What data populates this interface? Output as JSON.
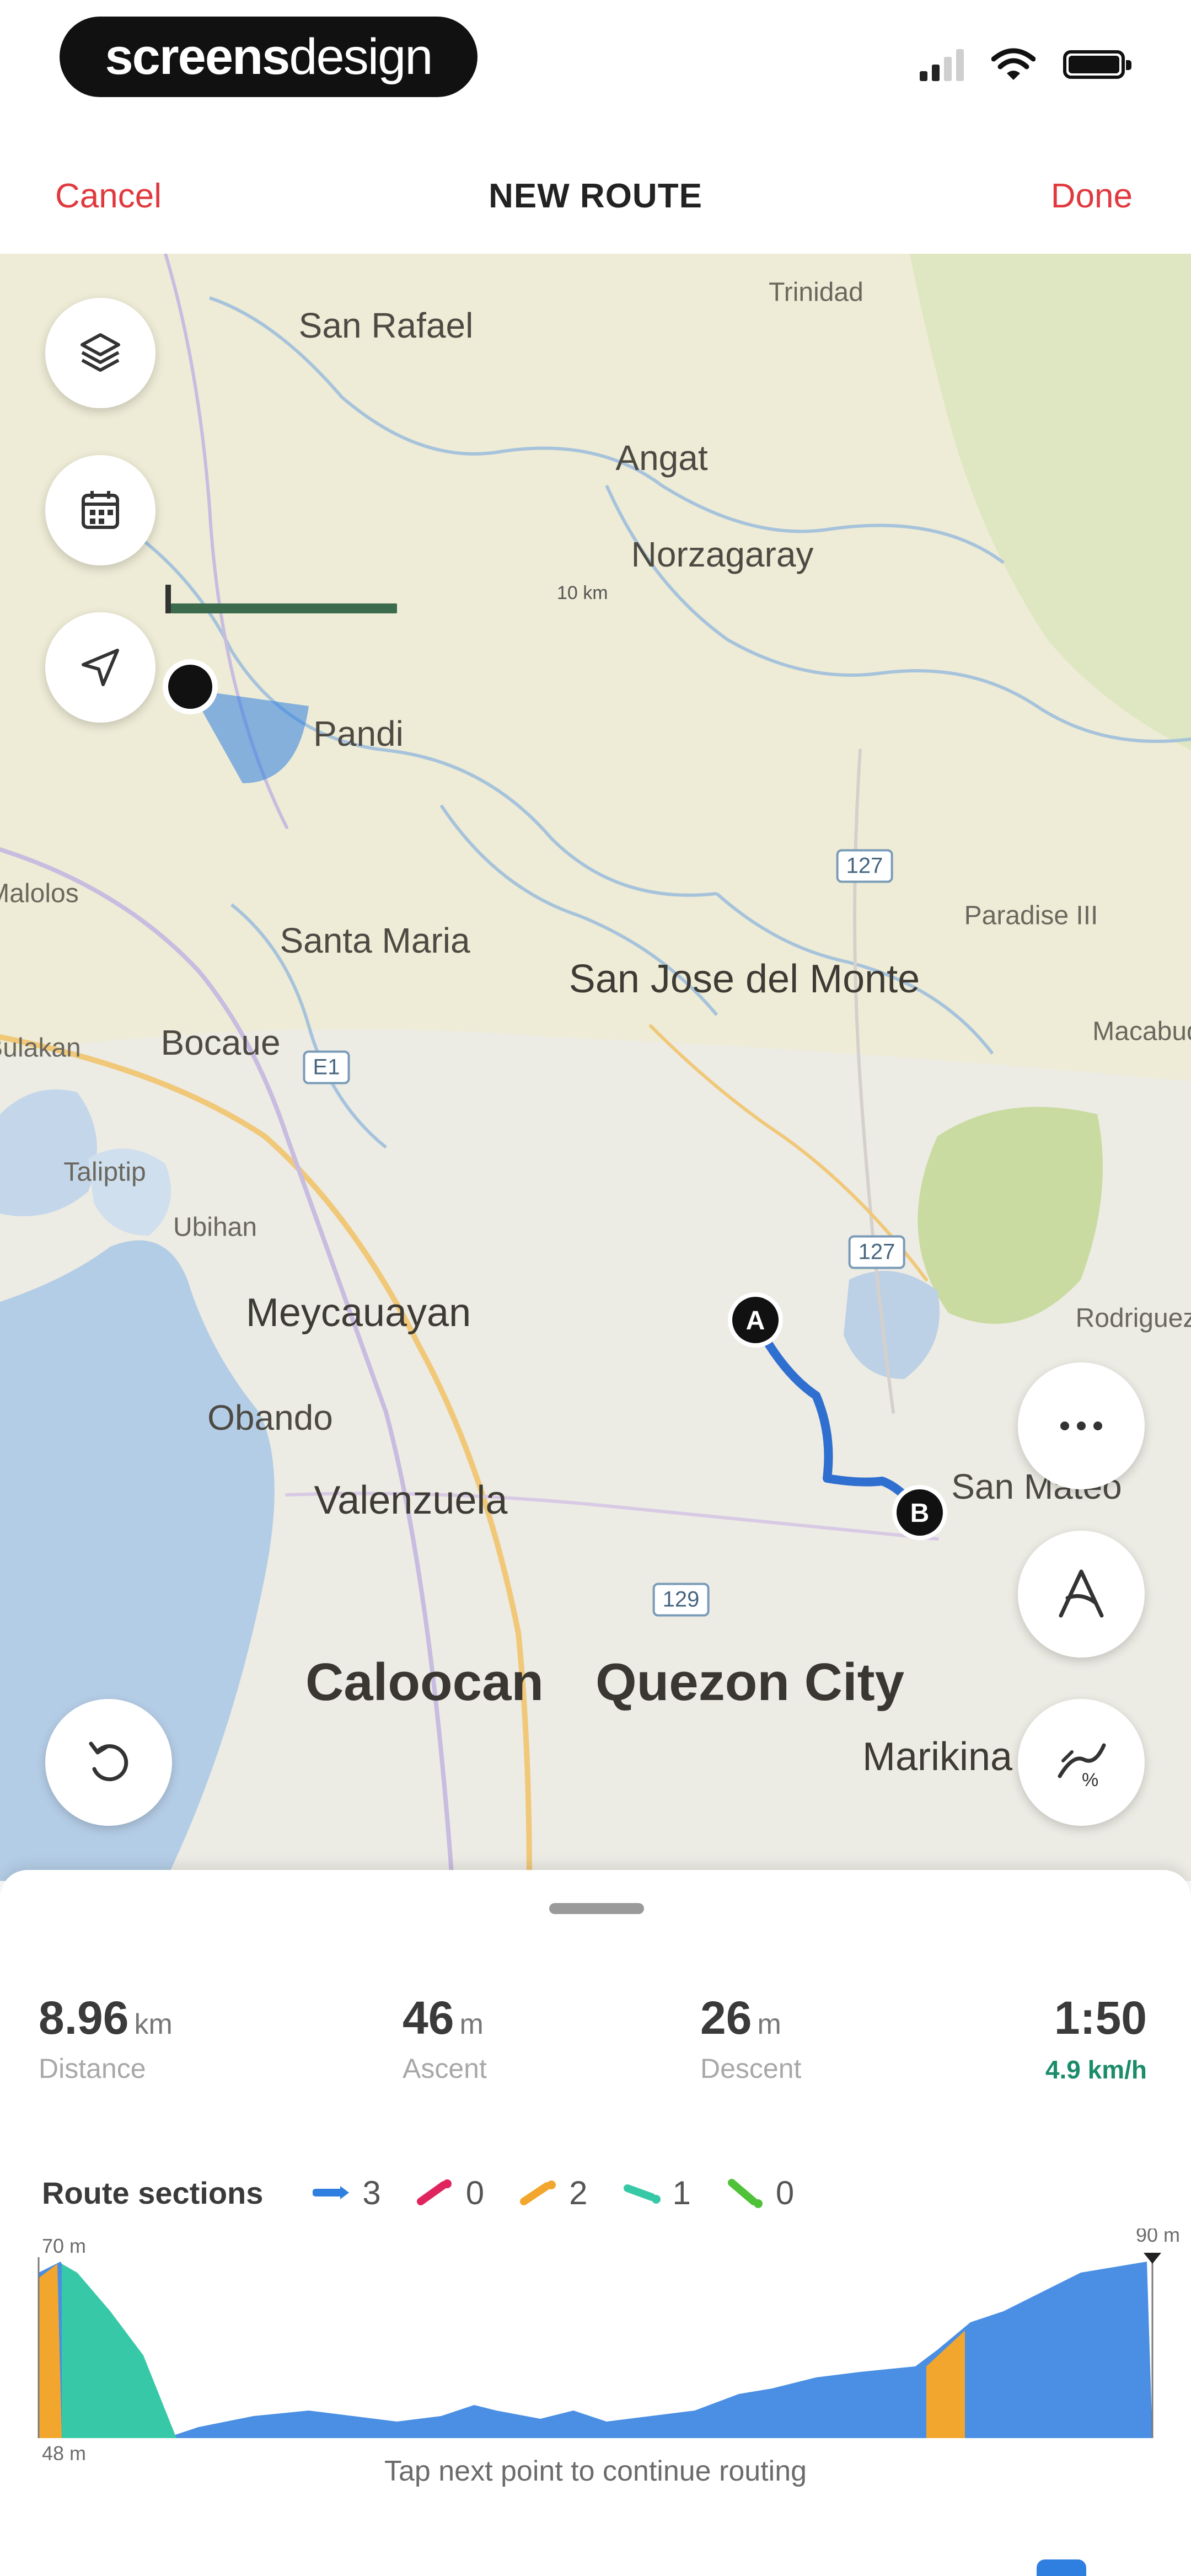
{
  "status_bar": {
    "brand_bold": "screens",
    "brand_light": "design"
  },
  "nav": {
    "cancel_label": "Cancel",
    "title": "NEW ROUTE",
    "done_label": "Done"
  },
  "map": {
    "scale_label": "10 km",
    "places": [
      {
        "name": "Trinidad"
      },
      {
        "name": "San Rafael"
      },
      {
        "name": "Angat"
      },
      {
        "name": "Norzagaray"
      },
      {
        "name": "Pandi"
      },
      {
        "name": "Paradise III"
      },
      {
        "name": "Santa Maria"
      },
      {
        "name": "San Jose del Monte"
      },
      {
        "name": "Bocaue"
      },
      {
        "name": "Macabud"
      },
      {
        "name": "Taliptip"
      },
      {
        "name": "Ubihan"
      },
      {
        "name": "Meycauayan"
      },
      {
        "name": "Rodriguez"
      },
      {
        "name": "Obando"
      },
      {
        "name": "San Mateo"
      },
      {
        "name": "Valenzuela"
      },
      {
        "name": "Caloocan"
      },
      {
        "name": "Quezon City"
      },
      {
        "name": "Marikina"
      },
      {
        "name": "Bulakan"
      },
      {
        "name": "Malolos"
      }
    ],
    "shields": [
      "127",
      "E1",
      "127",
      "129"
    ],
    "route": {
      "start_label": "A",
      "end_label": "B"
    },
    "icons": {
      "layers": "layers-icon",
      "calendar": "calendar-icon",
      "locate": "location-arrow-icon",
      "undo": "undo-icon",
      "more": "more-icon",
      "auto": "auto-route-icon",
      "slope": "slope-icon"
    }
  },
  "summary": {
    "distance_value": "8.96",
    "distance_unit": "km",
    "distance_label": "Distance",
    "ascent_value": "46",
    "ascent_unit": "m",
    "ascent_label": "Ascent",
    "descent_value": "26",
    "descent_unit": "m",
    "descent_label": "Descent",
    "time_value": "1:50",
    "speed": "4.9 km/h"
  },
  "route_sections": {
    "title": "Route sections",
    "items": [
      {
        "color": "#2f7fe0",
        "count": "3"
      },
      {
        "color": "#e0245e",
        "count": "0"
      },
      {
        "color": "#f2a62e",
        "count": "2"
      },
      {
        "color": "#37c9a7",
        "count": "1"
      },
      {
        "color": "#4fc23a",
        "count": "0"
      }
    ]
  },
  "elevation": {
    "max_label": "70 m",
    "min_label": "48 m",
    "end_label": "90 m",
    "hint": "Tap next point to continue routing"
  },
  "colors": {
    "accent_red": "#e0393e",
    "route_blue": "#2f6fd0",
    "speed_green": "#1c8c6b"
  }
}
